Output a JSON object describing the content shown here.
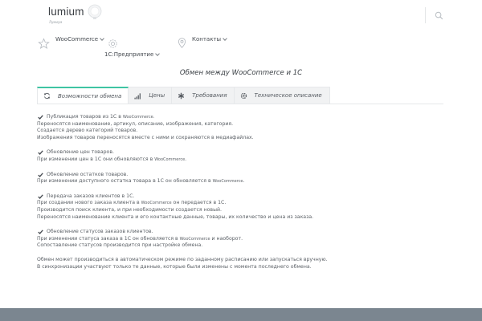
{
  "header": {
    "logo_name": "lumium",
    "logo_tagline": "Лумиум"
  },
  "nav": {
    "woocommerce": "WooCommerce",
    "contacts": "Контакты",
    "onec": "1С:Предприятие"
  },
  "page_title": "Обмен между WooCommerce и 1С",
  "tabs": [
    {
      "label": "Возможности обмена",
      "icon": "refresh-icon"
    },
    {
      "label": "Цены",
      "icon": "signal-bars-icon"
    },
    {
      "label": "Требования",
      "icon": "asterisk-icon"
    },
    {
      "label": "Техническое описание",
      "icon": "gear-icon"
    }
  ],
  "sections": [
    {
      "heading": "Публикация товаров из 1С в",
      "heading_wc": "WooCommerce.",
      "lines": [
        {
          "text": "Переносятся наименование, артикул, описание, изображения, категория.",
          "wc": "",
          "rest": ""
        },
        {
          "text": "Создается дерево категорий товаров.",
          "wc": "",
          "rest": ""
        },
        {
          "text": "Изображения товаров переносятся вместе с ними и сохраняются в медиафайлах.",
          "wc": "",
          "rest": ""
        }
      ]
    },
    {
      "heading": "Обновление цен товаров.",
      "heading_wc": "",
      "lines": [
        {
          "text": "При изменении цен в 1С они обновляются в ",
          "wc": "WooCommerce",
          "rest": "."
        }
      ]
    },
    {
      "heading": "Обновление остатков товаров.",
      "heading_wc": "",
      "lines": [
        {
          "text": "При изменении доступного остатка товара в 1С он обновляется в ",
          "wc": "WooCommerce",
          "rest": "."
        }
      ]
    },
    {
      "heading": "Передача заказов клиентов в 1С.",
      "heading_wc": "",
      "lines": [
        {
          "text": "При создании нового заказа клиента в ",
          "wc": "WooCommerce",
          "rest": " он передается в 1С."
        },
        {
          "text": "Производится поиск клиента, и при необходимости создается новый.",
          "wc": "",
          "rest": ""
        },
        {
          "text": "Переносятся наименование клиента и его контактные данные, товары, их количество и цена из заказа.",
          "wc": "",
          "rest": ""
        }
      ]
    },
    {
      "heading": "Обновление статусов заказов клиентов.",
      "heading_wc": "",
      "lines": [
        {
          "text": "При изменении статуса заказа в 1С он обновляется в ",
          "wc": "WooCommerce",
          "rest": " и наоборот."
        },
        {
          "text": "Сопоставление статусов производится при настройке обмена.",
          "wc": "",
          "rest": ""
        }
      ]
    }
  ],
  "footer_text": [
    "Обмен может производиться в автоматическом режиме по заданному расписанию или запускаться вручную.",
    "В синхронизации участвуют только те данные, которые были изменены с момента последнего обмена."
  ],
  "colors": {
    "accent": "#3fc4a3",
    "footer_bar": "#7b8690"
  }
}
